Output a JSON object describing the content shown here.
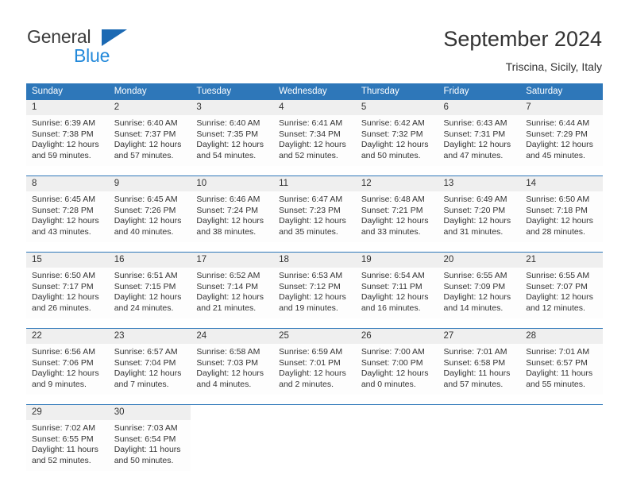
{
  "brand": {
    "name_part1": "General",
    "name_part2": "Blue",
    "triangle_color": "#1b69b3",
    "blue_text_color": "#2389da"
  },
  "header": {
    "title": "September 2024",
    "subtitle": "Triscina, Sicily, Italy"
  },
  "theme": {
    "header_bg": "#2e77b9",
    "header_text": "#ffffff",
    "daynum_bg": "#efefef",
    "cell_bg": "#fdfdfd",
    "separator": "#2e77b9",
    "text": "#333333"
  },
  "weekday_headers": [
    "Sunday",
    "Monday",
    "Tuesday",
    "Wednesday",
    "Thursday",
    "Friday",
    "Saturday"
  ],
  "weeks": [
    {
      "days": [
        {
          "num": "1",
          "sunrise": "Sunrise: 6:39 AM",
          "sunset": "Sunset: 7:38 PM",
          "daylight1": "Daylight: 12 hours",
          "daylight2": "and 59 minutes."
        },
        {
          "num": "2",
          "sunrise": "Sunrise: 6:40 AM",
          "sunset": "Sunset: 7:37 PM",
          "daylight1": "Daylight: 12 hours",
          "daylight2": "and 57 minutes."
        },
        {
          "num": "3",
          "sunrise": "Sunrise: 6:40 AM",
          "sunset": "Sunset: 7:35 PM",
          "daylight1": "Daylight: 12 hours",
          "daylight2": "and 54 minutes."
        },
        {
          "num": "4",
          "sunrise": "Sunrise: 6:41 AM",
          "sunset": "Sunset: 7:34 PM",
          "daylight1": "Daylight: 12 hours",
          "daylight2": "and 52 minutes."
        },
        {
          "num": "5",
          "sunrise": "Sunrise: 6:42 AM",
          "sunset": "Sunset: 7:32 PM",
          "daylight1": "Daylight: 12 hours",
          "daylight2": "and 50 minutes."
        },
        {
          "num": "6",
          "sunrise": "Sunrise: 6:43 AM",
          "sunset": "Sunset: 7:31 PM",
          "daylight1": "Daylight: 12 hours",
          "daylight2": "and 47 minutes."
        },
        {
          "num": "7",
          "sunrise": "Sunrise: 6:44 AM",
          "sunset": "Sunset: 7:29 PM",
          "daylight1": "Daylight: 12 hours",
          "daylight2": "and 45 minutes."
        }
      ]
    },
    {
      "days": [
        {
          "num": "8",
          "sunrise": "Sunrise: 6:45 AM",
          "sunset": "Sunset: 7:28 PM",
          "daylight1": "Daylight: 12 hours",
          "daylight2": "and 43 minutes."
        },
        {
          "num": "9",
          "sunrise": "Sunrise: 6:45 AM",
          "sunset": "Sunset: 7:26 PM",
          "daylight1": "Daylight: 12 hours",
          "daylight2": "and 40 minutes."
        },
        {
          "num": "10",
          "sunrise": "Sunrise: 6:46 AM",
          "sunset": "Sunset: 7:24 PM",
          "daylight1": "Daylight: 12 hours",
          "daylight2": "and 38 minutes."
        },
        {
          "num": "11",
          "sunrise": "Sunrise: 6:47 AM",
          "sunset": "Sunset: 7:23 PM",
          "daylight1": "Daylight: 12 hours",
          "daylight2": "and 35 minutes."
        },
        {
          "num": "12",
          "sunrise": "Sunrise: 6:48 AM",
          "sunset": "Sunset: 7:21 PM",
          "daylight1": "Daylight: 12 hours",
          "daylight2": "and 33 minutes."
        },
        {
          "num": "13",
          "sunrise": "Sunrise: 6:49 AM",
          "sunset": "Sunset: 7:20 PM",
          "daylight1": "Daylight: 12 hours",
          "daylight2": "and 31 minutes."
        },
        {
          "num": "14",
          "sunrise": "Sunrise: 6:50 AM",
          "sunset": "Sunset: 7:18 PM",
          "daylight1": "Daylight: 12 hours",
          "daylight2": "and 28 minutes."
        }
      ]
    },
    {
      "days": [
        {
          "num": "15",
          "sunrise": "Sunrise: 6:50 AM",
          "sunset": "Sunset: 7:17 PM",
          "daylight1": "Daylight: 12 hours",
          "daylight2": "and 26 minutes."
        },
        {
          "num": "16",
          "sunrise": "Sunrise: 6:51 AM",
          "sunset": "Sunset: 7:15 PM",
          "daylight1": "Daylight: 12 hours",
          "daylight2": "and 24 minutes."
        },
        {
          "num": "17",
          "sunrise": "Sunrise: 6:52 AM",
          "sunset": "Sunset: 7:14 PM",
          "daylight1": "Daylight: 12 hours",
          "daylight2": "and 21 minutes."
        },
        {
          "num": "18",
          "sunrise": "Sunrise: 6:53 AM",
          "sunset": "Sunset: 7:12 PM",
          "daylight1": "Daylight: 12 hours",
          "daylight2": "and 19 minutes."
        },
        {
          "num": "19",
          "sunrise": "Sunrise: 6:54 AM",
          "sunset": "Sunset: 7:11 PM",
          "daylight1": "Daylight: 12 hours",
          "daylight2": "and 16 minutes."
        },
        {
          "num": "20",
          "sunrise": "Sunrise: 6:55 AM",
          "sunset": "Sunset: 7:09 PM",
          "daylight1": "Daylight: 12 hours",
          "daylight2": "and 14 minutes."
        },
        {
          "num": "21",
          "sunrise": "Sunrise: 6:55 AM",
          "sunset": "Sunset: 7:07 PM",
          "daylight1": "Daylight: 12 hours",
          "daylight2": "and 12 minutes."
        }
      ]
    },
    {
      "days": [
        {
          "num": "22",
          "sunrise": "Sunrise: 6:56 AM",
          "sunset": "Sunset: 7:06 PM",
          "daylight1": "Daylight: 12 hours",
          "daylight2": "and 9 minutes."
        },
        {
          "num": "23",
          "sunrise": "Sunrise: 6:57 AM",
          "sunset": "Sunset: 7:04 PM",
          "daylight1": "Daylight: 12 hours",
          "daylight2": "and 7 minutes."
        },
        {
          "num": "24",
          "sunrise": "Sunrise: 6:58 AM",
          "sunset": "Sunset: 7:03 PM",
          "daylight1": "Daylight: 12 hours",
          "daylight2": "and 4 minutes."
        },
        {
          "num": "25",
          "sunrise": "Sunrise: 6:59 AM",
          "sunset": "Sunset: 7:01 PM",
          "daylight1": "Daylight: 12 hours",
          "daylight2": "and 2 minutes."
        },
        {
          "num": "26",
          "sunrise": "Sunrise: 7:00 AM",
          "sunset": "Sunset: 7:00 PM",
          "daylight1": "Daylight: 12 hours",
          "daylight2": "and 0 minutes."
        },
        {
          "num": "27",
          "sunrise": "Sunrise: 7:01 AM",
          "sunset": "Sunset: 6:58 PM",
          "daylight1": "Daylight: 11 hours",
          "daylight2": "and 57 minutes."
        },
        {
          "num": "28",
          "sunrise": "Sunrise: 7:01 AM",
          "sunset": "Sunset: 6:57 PM",
          "daylight1": "Daylight: 11 hours",
          "daylight2": "and 55 minutes."
        }
      ]
    },
    {
      "days": [
        {
          "num": "29",
          "sunrise": "Sunrise: 7:02 AM",
          "sunset": "Sunset: 6:55 PM",
          "daylight1": "Daylight: 11 hours",
          "daylight2": "and 52 minutes."
        },
        {
          "num": "30",
          "sunrise": "Sunrise: 7:03 AM",
          "sunset": "Sunset: 6:54 PM",
          "daylight1": "Daylight: 11 hours",
          "daylight2": "and 50 minutes."
        },
        {
          "num": "",
          "sunrise": "",
          "sunset": "",
          "daylight1": "",
          "daylight2": ""
        },
        {
          "num": "",
          "sunrise": "",
          "sunset": "",
          "daylight1": "",
          "daylight2": ""
        },
        {
          "num": "",
          "sunrise": "",
          "sunset": "",
          "daylight1": "",
          "daylight2": ""
        },
        {
          "num": "",
          "sunrise": "",
          "sunset": "",
          "daylight1": "",
          "daylight2": ""
        },
        {
          "num": "",
          "sunrise": "",
          "sunset": "",
          "daylight1": "",
          "daylight2": ""
        }
      ]
    }
  ]
}
